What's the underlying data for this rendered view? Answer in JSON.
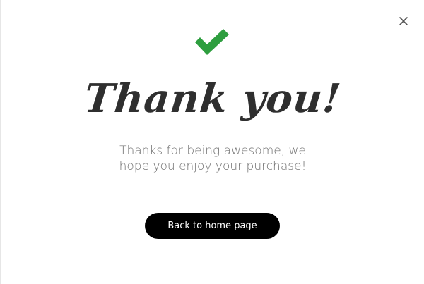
{
  "dialog": {
    "close_icon": "close-icon",
    "success_icon": "checkmark-icon",
    "title": "Thank you!",
    "message_line_1": "Thanks for being awesome, we",
    "message_line_2": "hope you enjoy your purchase!",
    "button_label": "Back to home page"
  },
  "colors": {
    "check": "#2e9e3f",
    "title": "#2f2f2f",
    "message": "#707070",
    "button_bg": "#000000",
    "button_text": "#ffffff",
    "close": "#555555"
  }
}
